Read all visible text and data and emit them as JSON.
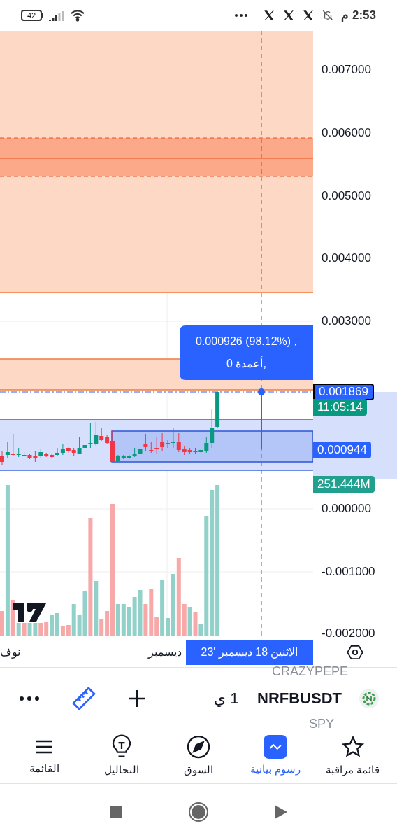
{
  "status_bar": {
    "time": "2:53",
    "period": "م",
    "battery": "42"
  },
  "chart": {
    "price_axis": [
      {
        "label": "0.007000"
      },
      {
        "label": "0.006000"
      },
      {
        "label": "0.005000"
      },
      {
        "label": "0.004000"
      },
      {
        "label": "0.003000"
      },
      {
        "label": "0.000000"
      },
      {
        "label": "-0.001000"
      },
      {
        "label": "-0.002000"
      }
    ],
    "tooltip": {
      "line_1": "0.000926 (98.12%) ,",
      "line_2": "0 أعمدة,"
    },
    "price_tags": [
      {
        "kind": "price",
        "label": "0.001869",
        "outlined": true
      },
      {
        "kind": "countdown",
        "label": "11:05:14",
        "outlined": false
      },
      {
        "kind": "price",
        "label": "0.000944",
        "outlined": false
      },
      {
        "kind": "volume",
        "label": "251.444M",
        "outlined": false
      }
    ],
    "time_axis": [
      "ديسمبر",
      "نوف"
    ],
    "crosshair_date": "الاثنين 18 ديسمبر '23"
  },
  "toolbar": {
    "symbol": "NRFBUSDT",
    "interval": "1 ي",
    "ghost_symbols": [
      "CRAZYPEPE",
      "SPY"
    ]
  },
  "bottom_nav": [
    {
      "kind": "watchlist",
      "label": "قائمة مراقبة",
      "selected": false
    },
    {
      "kind": "charts",
      "label": "رسوم بيانية",
      "selected": true
    },
    {
      "kind": "market",
      "label": "السوق",
      "selected": false
    },
    {
      "kind": "ideas",
      "label": "التحاليل",
      "selected": false
    },
    {
      "kind": "menu",
      "label": "القائمة",
      "selected": false
    }
  ]
}
